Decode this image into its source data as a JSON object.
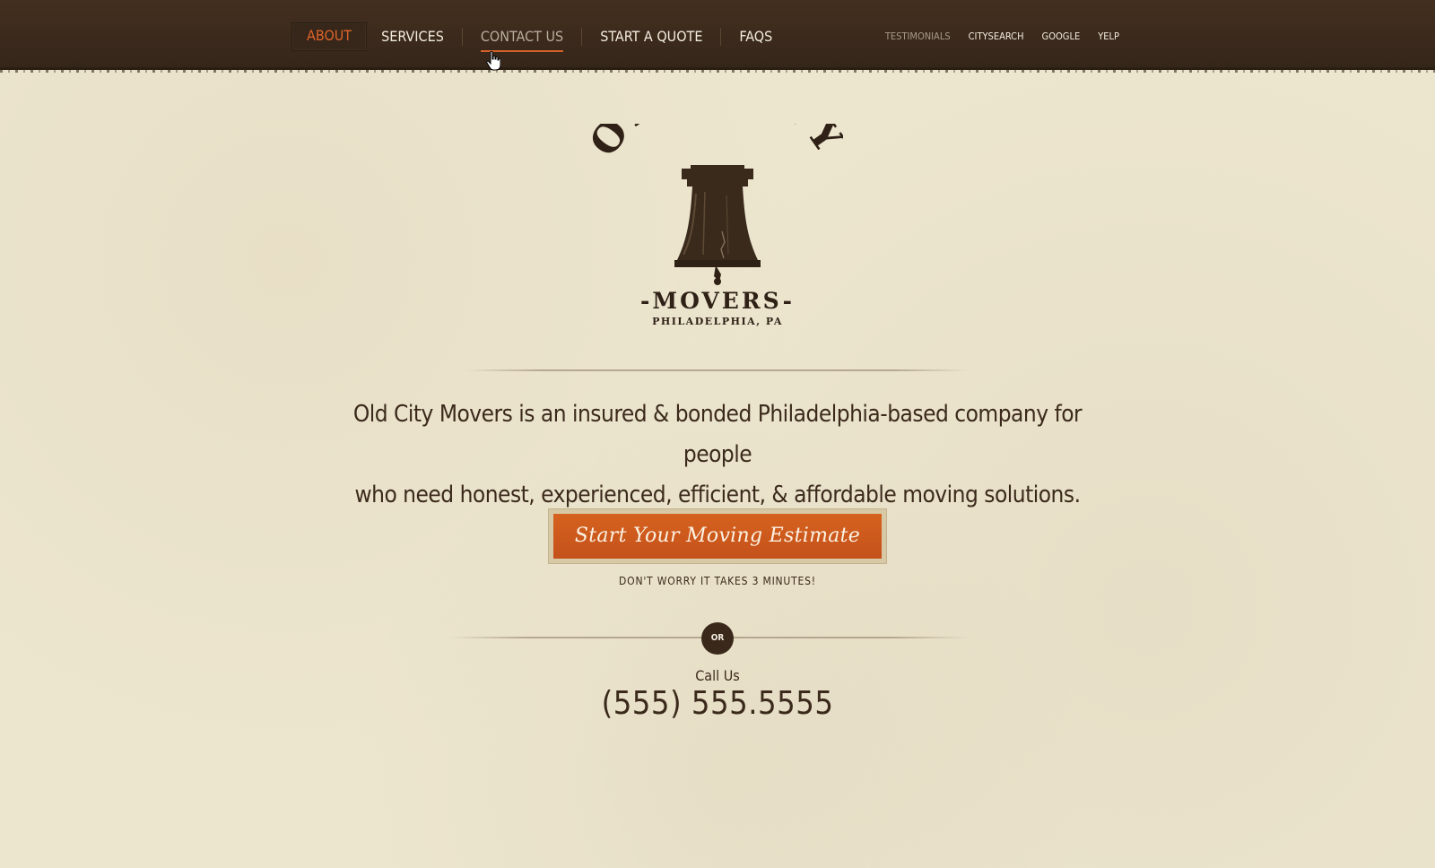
{
  "nav": {
    "items": [
      {
        "label": "ABOUT"
      },
      {
        "label": "SERVICES"
      },
      {
        "label": "CONTACT US"
      },
      {
        "label": "START A QUOTE"
      },
      {
        "label": "FAQS"
      }
    ]
  },
  "subnav": {
    "items": [
      {
        "label": "TESTIMONIALS"
      },
      {
        "label": "CITYSEARCH"
      },
      {
        "label": "GOOGLE"
      },
      {
        "label": "YELP"
      }
    ]
  },
  "logo": {
    "arc_text": "OLD CITY",
    "movers": "-MOVERS-",
    "location": "PHILADELPHIA, PA"
  },
  "tagline": {
    "line1": "Old City Movers is an insured & bonded Philadelphia-based company for people",
    "line2": "who need honest, experienced, efficient, & affordable moving solutions."
  },
  "cta": {
    "label": "Start Your Moving Estimate",
    "note": "DON'T WORRY IT TAKES 3 MINUTES!"
  },
  "divider": {
    "or": "OR"
  },
  "contact": {
    "call_label": "Call Us",
    "phone": "(555) 555.5555"
  },
  "colors": {
    "topbar": "#3d2c1d",
    "background": "#ede6cf",
    "accent": "#cf5a1e",
    "text": "#3b2a1c"
  },
  "icons": {
    "logo_bell": "liberty-bell-icon",
    "cursor": "hand-pointer-icon"
  }
}
